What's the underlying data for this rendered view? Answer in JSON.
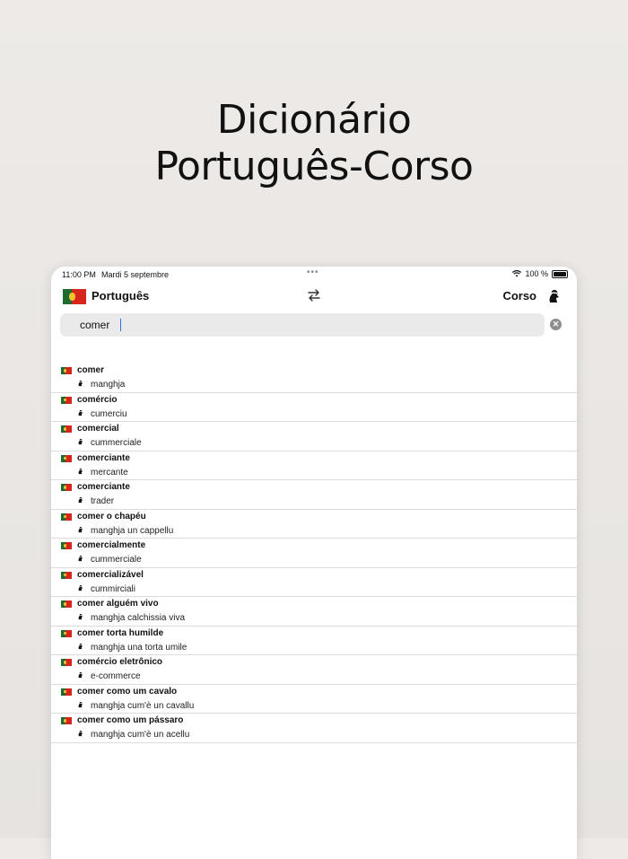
{
  "hero": {
    "line1": "Dicionário",
    "line2": "Português-Corso"
  },
  "status": {
    "time": "11:00 PM",
    "date": "Mardi 5 septembre",
    "battery": "100 %"
  },
  "nav": {
    "source_language": "Português",
    "target_language": "Corso"
  },
  "search": {
    "value": "comer",
    "placeholder": ""
  },
  "results": [
    {
      "term": "comer",
      "translation": "manghja"
    },
    {
      "term": "comércio",
      "translation": "cumerciu"
    },
    {
      "term": "comercial",
      "translation": "cummerciale"
    },
    {
      "term": "comerciante",
      "translation": "mercante"
    },
    {
      "term": "comerciante",
      "translation": "trader"
    },
    {
      "term": "comer o chapéu",
      "translation": "manghja un cappellu"
    },
    {
      "term": "comercialmente",
      "translation": "cummerciale"
    },
    {
      "term": "comercializável",
      "translation": "cummirciali"
    },
    {
      "term": "comer alguém vivo",
      "translation": "manghja calchissia viva"
    },
    {
      "term": "comer torta humilde",
      "translation": "manghja una torta umile"
    },
    {
      "term": "comércio eletrônico",
      "translation": "e-commerce"
    },
    {
      "term": "comer como um cavalo",
      "translation": "manghja cum'è un cavallu"
    },
    {
      "term": "comer como um pássaro",
      "translation": "manghja cum'è un acellu"
    }
  ],
  "icons": {
    "source_flag": "portugal-flag-icon",
    "target_flag": "corsican-moor-icon",
    "swap": "swap-arrows-icon",
    "clear": "clear-icon",
    "wifi": "wifi-icon",
    "battery": "battery-icon"
  },
  "colors": {
    "accent": "#2b6fe8",
    "flag_red": "#d6261c",
    "flag_green": "#1d6b2e"
  }
}
